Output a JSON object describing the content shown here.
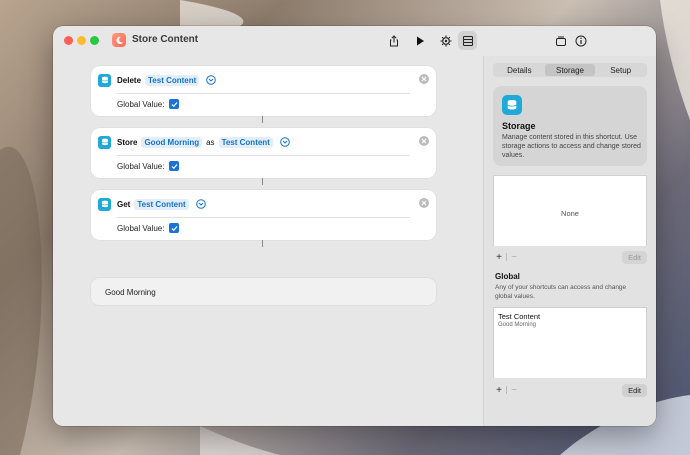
{
  "window": {
    "title": "Store Content"
  },
  "actions": [
    {
      "verb": "Delete",
      "tokens": [
        {
          "type": "token",
          "text": "Test Content"
        }
      ],
      "param_label": "Global Value:",
      "checked": true
    },
    {
      "verb": "Store",
      "tokens": [
        {
          "type": "token",
          "text": "Good Morning"
        },
        {
          "type": "word",
          "text": "as"
        },
        {
          "type": "token",
          "text": "Test Content"
        }
      ],
      "param_label": "Global Value:",
      "checked": true
    },
    {
      "verb": "Get",
      "tokens": [
        {
          "type": "token",
          "text": "Test Content"
        }
      ],
      "param_label": "Global Value:",
      "checked": true
    }
  ],
  "output": {
    "text": "Good Morning"
  },
  "sidebar": {
    "tabs": [
      {
        "label": "Details",
        "active": false
      },
      {
        "label": "Storage",
        "active": true
      },
      {
        "label": "Setup",
        "active": false
      }
    ],
    "info": {
      "title": "Storage",
      "description": "Manage content stored in this shortcut. Use storage actions to access and change stored values."
    },
    "local_list": {
      "empty_text": "None",
      "add_label": "+",
      "remove_label": "−",
      "edit_label": "Edit"
    },
    "global": {
      "title": "Global",
      "description": "Any of your shortcuts can access and change global values.",
      "entries": [
        {
          "title": "Test Content",
          "value": "Good Morning"
        }
      ],
      "add_label": "+",
      "remove_label": "−",
      "edit_label": "Edit"
    }
  },
  "colors": {
    "accent": "#1a73d9",
    "token_text": "#1573c9",
    "storage_icon": "#1fa9d9"
  }
}
